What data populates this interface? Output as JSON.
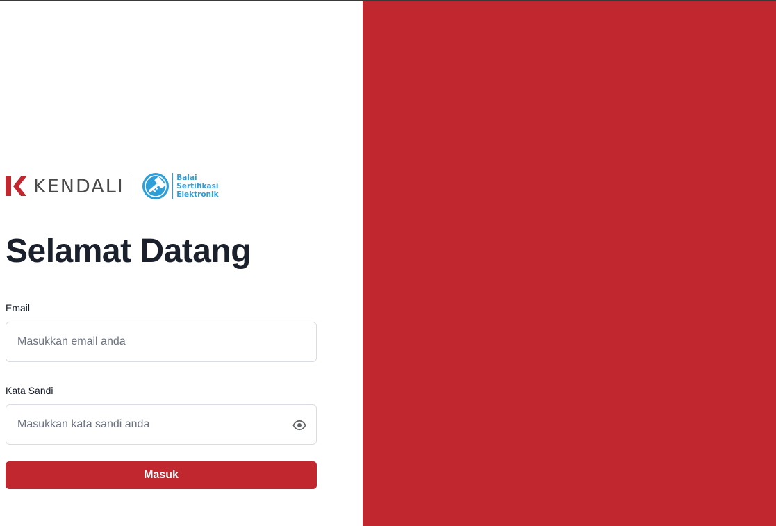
{
  "brand": {
    "name": "KENDALI",
    "partner_lines": [
      "Balai",
      "Sertifikasi",
      "Elektronik"
    ]
  },
  "login": {
    "title": "Selamat Datang",
    "email_label": "Email",
    "email_placeholder": "Masukkan email anda",
    "email_value": "",
    "password_label": "Kata Sandi",
    "password_placeholder": "Masukkan kata sandi anda",
    "password_value": "",
    "submit_label": "Masuk"
  },
  "colors": {
    "brand_red": "#c1272f",
    "partner_blue": "#2f9fda"
  },
  "icons": {
    "brand_mark": "kendali-logo-icon",
    "partner_mark": "bse-logo-icon",
    "password_toggle": "eye-icon"
  }
}
